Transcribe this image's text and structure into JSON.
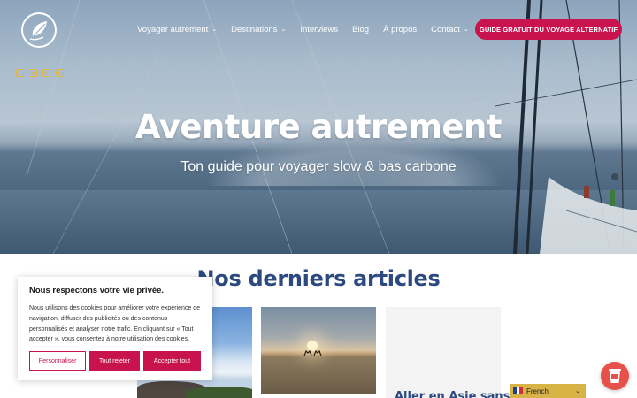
{
  "header": {
    "nav": [
      {
        "label": "Voyager autrement",
        "has_dropdown": true
      },
      {
        "label": "Destinations",
        "has_dropdown": true
      },
      {
        "label": "Interviews",
        "has_dropdown": false
      },
      {
        "label": "Blog",
        "has_dropdown": false
      },
      {
        "label": "À propos",
        "has_dropdown": false
      },
      {
        "label": "Contact",
        "has_dropdown": true
      }
    ],
    "cta_label": "GUIDE GRATUIT DU VOYAGE ALTERNATIF",
    "socials": [
      "instagram-icon",
      "pinterest-icon",
      "facebook-icon",
      "youtube-icon"
    ]
  },
  "hero": {
    "title": "Aventure autrement",
    "subtitle": "Ton guide pour voyager slow & bas carbone"
  },
  "articles": {
    "section_title": "Nos derniers articles",
    "card3_title": "Aller en Asie sans"
  },
  "cookie": {
    "title": "Nous respectons votre vie privée.",
    "text": "Nous utilisons des cookies pour améliorer votre expérience de navigation, diffuser des publicités ou des contenus personnalisés et analyser notre trafic. En cliquant sur « Tout accepter », vous consentez à notre utilisation des cookies.",
    "buttons": {
      "customize": "Personnaliser",
      "reject": "Tout rejeter",
      "accept": "Accepter tout"
    }
  },
  "language": {
    "selected": "French"
  },
  "colors": {
    "accent": "#c8134e",
    "title_blue": "#2c4a80",
    "social_yellow": "#e5b53a",
    "lang_bg": "#d8b447"
  }
}
